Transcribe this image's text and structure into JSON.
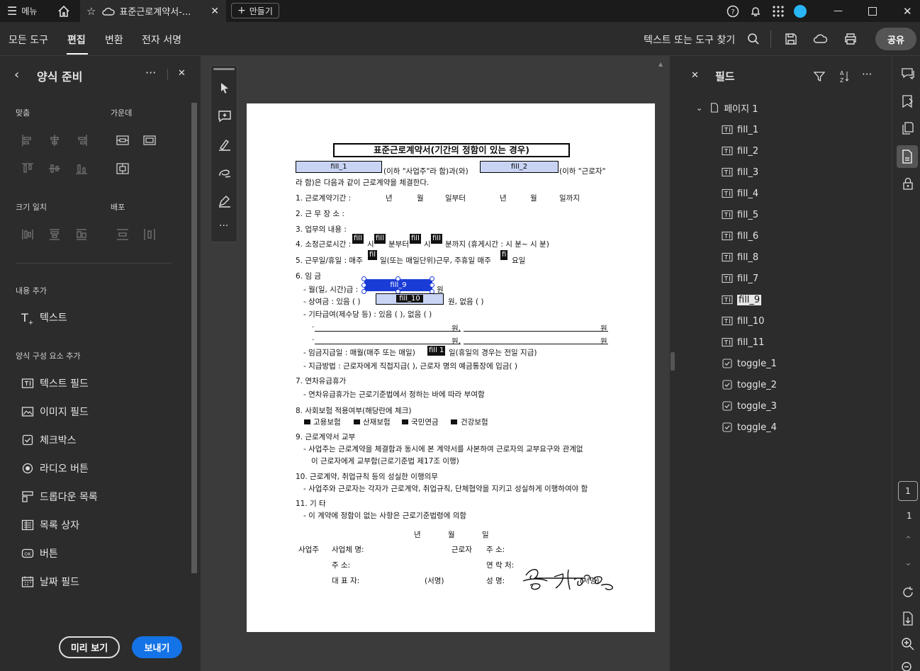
{
  "tabbar": {
    "menu_label": "메뉴",
    "tab_title": "표준근로계약서-...",
    "new_button": "만들기"
  },
  "toolbar": {
    "menus": [
      "모든 도구",
      "편집",
      "변환",
      "전자 서명"
    ],
    "active_menu": "편집",
    "search_placeholder": "텍스트 또는 도구 찾기",
    "share_label": "공유"
  },
  "left_panel": {
    "title": "양식 준비",
    "sections": {
      "align": "맞춤",
      "center": "가운데",
      "size": "크기 일치",
      "distribute": "배포",
      "add_content": "내용 추가",
      "add_form": "양식 구성 요소 추가"
    },
    "add_text": "텍스트",
    "form_items": [
      "텍스트 필드",
      "이미지 필드",
      "체크박스",
      "라디오 버튼",
      "드롭다운 목록",
      "목록 상자",
      "버튼",
      "날짜 필드"
    ],
    "preview_label": "미리 보기",
    "export_label": "보내기"
  },
  "document": {
    "title": "표준근로계약서(기간의 정함이 있는 경우)",
    "fields": {
      "f1": "fill_1",
      "f2": "fill_2",
      "f9": "fill_9",
      "f10": "fill_10",
      "fillShort": "fill",
      "fil": "fil",
      "fi": "fi",
      "f11": "fill 1"
    },
    "l1a": "(이하 \"사업주\"라 함)과(와)",
    "l1b": "(이하 \"근로자\"",
    "l2": "라 함)은 다음과 같이 근로계약을 체결한다.",
    "l3": "1. 근로계약기간 :",
    "l3_y": "년",
    "l3_m": "월",
    "l3_d": "일부터",
    "l3_y2": "년",
    "l3_m2": "월",
    "l3_d2": "일까지",
    "l4": "2. 근 무 장 소 :",
    "l5": "3. 업무의 내용 :",
    "l6a": "4. 소정근로시간 :",
    "l6b": "시",
    "l6c": "분부터",
    "l6d": "시",
    "l6e": "분까지 (휴게시간 :     시    분~    시    분)",
    "l7a": "5. 근무일/휴일 : 매주",
    "l7b": "일(또는 매일단위)근무, 주휴일 매주",
    "l7c": "요일",
    "l8": "6. 임 금",
    "l9": "- 월(일, 시간)급 :",
    "l9b": "원",
    "l10a": "- 상여금 : 있음 (      )",
    "l10b": "원, 없음 (      )",
    "l11": "- 기타급여(제수당 등) : 있음 (      ), 없음 (      )",
    "l12a": "·",
    "l12b": "원,",
    "l12c": "원",
    "l14a": "- 임금지급일 : 매월(매주 또는 매일)",
    "l14b": "일(휴일의 경우는 전일 지급)",
    "l15": "- 지급방법 : 근로자에게 직접지급(      ), 근로자 명의 예금통장에 입금(      )",
    "l16": "7. 연차유급휴가",
    "l17": "- 연차유급휴가는 근로기준법에서 정하는 바에 따라 부여함",
    "l18": "8. 사회보험 적용여부(해당란에 체크)",
    "l19": [
      "고용보험",
      "산재보험",
      "국민연금",
      "건강보험"
    ],
    "l20": "9. 근로계약서 교부",
    "l21": "- 사업주는 근로계약을 체결함과 동시에 본 계약서를 사본하여 근로자의 교부요구와 관계없",
    "l22": "이 근로자에게 교부함(근로기준법 제17조 이행)",
    "l23": "10. 근로계약, 취업규칙 등의 성실한 이행의무",
    "l24": "- 사업주와 근로자는 각자가 근로계약, 취업규칙, 단체협약을 지키고 성실하게 이행하여야 함",
    "l25": "11. 기 타",
    "l26": "- 이 계약에 정함이 없는 사항은 근로기준법령에 의함",
    "date_y": "년",
    "date_m": "월",
    "date_d": "일",
    "emp": "사업주",
    "emp_name": "사업체 명:",
    "emp_addr": "주       소:",
    "emp_rep": "대  표  자:",
    "sign": "(서명)",
    "worker": "근로자",
    "w_addr": "주       소:",
    "w_tel": "연  락  처:",
    "w_name": "성       명:",
    "w_sign": "(서명)"
  },
  "right_panel": {
    "title": "필드",
    "page_node": "페이지 1",
    "fields": [
      "fill_1",
      "fill_2",
      "fill_3",
      "fill_4",
      "fill_5",
      "fill_6",
      "fill_8",
      "fill_7",
      "fill_9",
      "fill_10",
      "fill_11"
    ],
    "toggles": [
      "toggle_1",
      "toggle_2",
      "toggle_3",
      "toggle_4"
    ],
    "selected": "fill_9"
  },
  "page_nav": {
    "current": "1",
    "total": "1"
  },
  "colors": {
    "accent": "#1473e6",
    "selection": "#1a3cd6",
    "bg": "#2c2c2c"
  }
}
